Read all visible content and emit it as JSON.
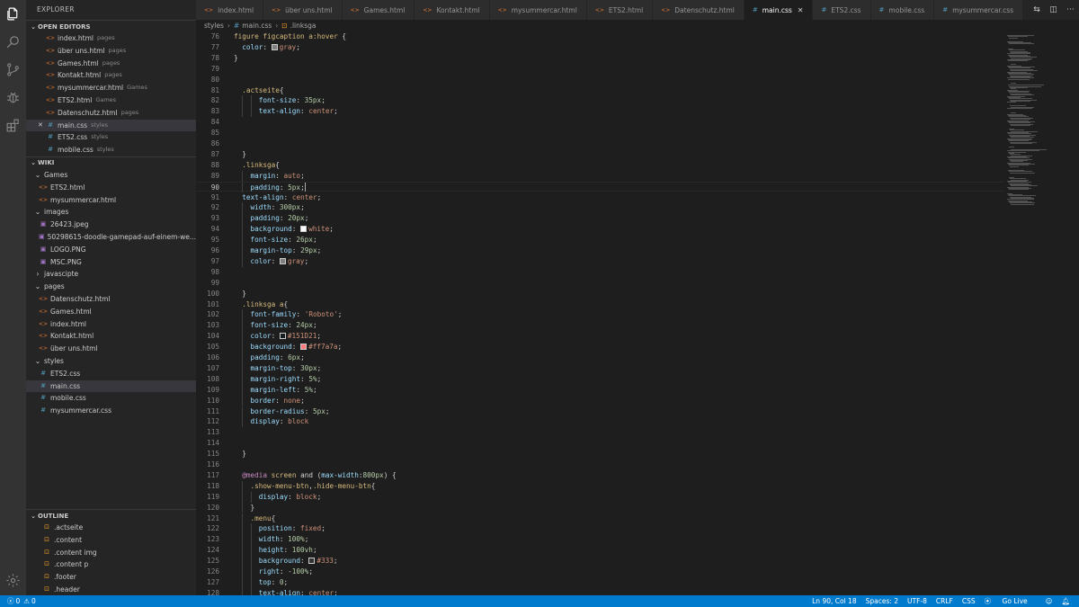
{
  "sidebar": {
    "title": "EXPLORER",
    "open_editors_header": "OPEN EDITORS",
    "open_editors": [
      {
        "name": "index.html",
        "folder": "pages",
        "type": "html"
      },
      {
        "name": "über uns.html",
        "folder": "pages",
        "type": "html"
      },
      {
        "name": "Games.html",
        "folder": "pages",
        "type": "html"
      },
      {
        "name": "Kontakt.html",
        "folder": "pages",
        "type": "html"
      },
      {
        "name": "mysummercar.html",
        "folder": "Games",
        "type": "html"
      },
      {
        "name": "ETS2.html",
        "folder": "Games",
        "type": "html"
      },
      {
        "name": "Datenschutz.html",
        "folder": "pages",
        "type": "html"
      },
      {
        "name": "main.css",
        "folder": "styles",
        "type": "css",
        "selected": true
      },
      {
        "name": "ETS2.css",
        "folder": "styles",
        "type": "css"
      },
      {
        "name": "mobile.css",
        "folder": "styles",
        "type": "css"
      }
    ],
    "workspace_header": "WIKI",
    "tree": [
      {
        "label": "Games",
        "kind": "folder",
        "depth": 1,
        "open": true
      },
      {
        "label": "ETS2.html",
        "kind": "html",
        "depth": 2
      },
      {
        "label": "mysummercar.html",
        "kind": "html",
        "depth": 2
      },
      {
        "label": "images",
        "kind": "folder",
        "depth": 1,
        "open": true
      },
      {
        "label": "26423.jpeg",
        "kind": "img",
        "depth": 2
      },
      {
        "label": "50298615-doodle-gamepad-auf-einem-we...",
        "kind": "img",
        "depth": 2
      },
      {
        "label": "LOGO.PNG",
        "kind": "img",
        "depth": 2
      },
      {
        "label": "MSC.PNG",
        "kind": "img",
        "depth": 2
      },
      {
        "label": "javascipte",
        "kind": "folder",
        "depth": 1,
        "open": false
      },
      {
        "label": "pages",
        "kind": "folder",
        "depth": 1,
        "open": true
      },
      {
        "label": "Datenschutz.html",
        "kind": "html",
        "depth": 2
      },
      {
        "label": "Games.html",
        "kind": "html",
        "depth": 2
      },
      {
        "label": "index.html",
        "kind": "html",
        "depth": 2
      },
      {
        "label": "Kontakt.html",
        "kind": "html",
        "depth": 2
      },
      {
        "label": "über uns.html",
        "kind": "html",
        "depth": 2
      },
      {
        "label": "styles",
        "kind": "folder",
        "depth": 1,
        "open": true
      },
      {
        "label": "ETS2.css",
        "kind": "css",
        "depth": 2
      },
      {
        "label": "main.css",
        "kind": "css",
        "depth": 2,
        "selected": true
      },
      {
        "label": "mobile.css",
        "kind": "css",
        "depth": 2
      },
      {
        "label": "mysummercar.css",
        "kind": "css",
        "depth": 2
      }
    ],
    "outline_header": "OUTLINE",
    "outline": [
      ".actseite",
      ".content",
      ".content img",
      ".content p",
      ".footer",
      ".header"
    ]
  },
  "tabs": [
    {
      "label": "index.html",
      "type": "html"
    },
    {
      "label": "über uns.html",
      "type": "html"
    },
    {
      "label": "Games.html",
      "type": "html"
    },
    {
      "label": "Kontakt.html",
      "type": "html"
    },
    {
      "label": "mysummercar.html",
      "type": "html"
    },
    {
      "label": "ETS2.html",
      "type": "html"
    },
    {
      "label": "Datenschutz.html",
      "type": "html"
    },
    {
      "label": "main.css",
      "type": "css",
      "active": true
    },
    {
      "label": "ETS2.css",
      "type": "css"
    },
    {
      "label": "mobile.css",
      "type": "css"
    },
    {
      "label": "mysummercar.css",
      "type": "css"
    }
  ],
  "breadcrumb": [
    "styles",
    "main.css",
    ".linksga"
  ],
  "editor": {
    "current_line": 90,
    "lines": [
      {
        "n": 76,
        "i": 0,
        "t": [
          [
            "sel",
            "figure figcaption a:hover "
          ],
          [
            "punc",
            "{"
          ]
        ]
      },
      {
        "n": 77,
        "i": 1,
        "t": [
          [
            "prop",
            "color"
          ],
          [
            "punc",
            ": "
          ],
          [
            "sw",
            "#808080"
          ],
          [
            "val",
            "gray"
          ],
          [
            "punc",
            ";"
          ]
        ]
      },
      {
        "n": 78,
        "i": 0,
        "t": [
          [
            "punc",
            "}"
          ]
        ]
      },
      {
        "n": 79,
        "i": 0,
        "t": []
      },
      {
        "n": 80,
        "i": 0,
        "t": []
      },
      {
        "n": 81,
        "i": 1,
        "t": [
          [
            "sel",
            ".actseite"
          ],
          [
            "punc",
            "{"
          ]
        ]
      },
      {
        "n": 82,
        "i": 3,
        "t": [
          [
            "prop",
            "font-size"
          ],
          [
            "punc",
            ": "
          ],
          [
            "num",
            "35px"
          ],
          [
            "punc",
            ";"
          ]
        ]
      },
      {
        "n": 83,
        "i": 3,
        "t": [
          [
            "prop",
            "text-align"
          ],
          [
            "punc",
            ": "
          ],
          [
            "val",
            "center"
          ],
          [
            "punc",
            ";"
          ]
        ]
      },
      {
        "n": 84,
        "i": 0,
        "t": []
      },
      {
        "n": 85,
        "i": 0,
        "t": []
      },
      {
        "n": 86,
        "i": 0,
        "t": []
      },
      {
        "n": 87,
        "i": 1,
        "t": [
          [
            "punc",
            "}"
          ]
        ]
      },
      {
        "n": 88,
        "i": 1,
        "t": [
          [
            "sel",
            ".linksga"
          ],
          [
            "punc",
            "{"
          ]
        ]
      },
      {
        "n": 89,
        "i": 2,
        "t": [
          [
            "prop",
            "margin"
          ],
          [
            "punc",
            ": "
          ],
          [
            "val",
            "auto"
          ],
          [
            "punc",
            ";"
          ]
        ]
      },
      {
        "n": 90,
        "i": 2,
        "t": [
          [
            "prop",
            "padding"
          ],
          [
            "punc",
            ": "
          ],
          [
            "num",
            "5px"
          ],
          [
            "punc",
            ";"
          ],
          [
            "cursor",
            ""
          ]
        ]
      },
      {
        "n": 91,
        "i": 1,
        "t": [
          [
            "prop",
            "text-align"
          ],
          [
            "punc",
            ": "
          ],
          [
            "val",
            "center"
          ],
          [
            "punc",
            ";"
          ]
        ]
      },
      {
        "n": 92,
        "i": 2,
        "t": [
          [
            "prop",
            "width"
          ],
          [
            "punc",
            ": "
          ],
          [
            "num",
            "300px"
          ],
          [
            "punc",
            ";"
          ]
        ]
      },
      {
        "n": 93,
        "i": 2,
        "t": [
          [
            "prop",
            "padding"
          ],
          [
            "punc",
            ": "
          ],
          [
            "num",
            "20px"
          ],
          [
            "punc",
            ";"
          ]
        ]
      },
      {
        "n": 94,
        "i": 2,
        "t": [
          [
            "prop",
            "background"
          ],
          [
            "punc",
            ": "
          ],
          [
            "sw",
            "#ffffff"
          ],
          [
            "val",
            "white"
          ],
          [
            "punc",
            ";"
          ]
        ]
      },
      {
        "n": 95,
        "i": 2,
        "t": [
          [
            "prop",
            "font-size"
          ],
          [
            "punc",
            ": "
          ],
          [
            "num",
            "26px"
          ],
          [
            "punc",
            ";"
          ]
        ]
      },
      {
        "n": 96,
        "i": 2,
        "t": [
          [
            "prop",
            "margin-top"
          ],
          [
            "punc",
            ": "
          ],
          [
            "num",
            "29px"
          ],
          [
            "punc",
            ";"
          ]
        ]
      },
      {
        "n": 97,
        "i": 2,
        "t": [
          [
            "prop",
            "color"
          ],
          [
            "punc",
            ": "
          ],
          [
            "sw",
            "#808080"
          ],
          [
            "val",
            "gray"
          ],
          [
            "punc",
            ";"
          ]
        ]
      },
      {
        "n": 98,
        "i": 0,
        "t": []
      },
      {
        "n": 99,
        "i": 0,
        "t": []
      },
      {
        "n": 100,
        "i": 1,
        "t": [
          [
            "punc",
            "}"
          ]
        ]
      },
      {
        "n": 101,
        "i": 1,
        "t": [
          [
            "sel",
            ".linksga a"
          ],
          [
            "punc",
            "{"
          ]
        ]
      },
      {
        "n": 102,
        "i": 2,
        "t": [
          [
            "prop",
            "font-family"
          ],
          [
            "punc",
            ": "
          ],
          [
            "val",
            "'Roboto'"
          ],
          [
            "punc",
            ";"
          ]
        ]
      },
      {
        "n": 103,
        "i": 2,
        "t": [
          [
            "prop",
            "font-size"
          ],
          [
            "punc",
            ": "
          ],
          [
            "num",
            "24px"
          ],
          [
            "punc",
            ";"
          ]
        ]
      },
      {
        "n": 104,
        "i": 2,
        "t": [
          [
            "prop",
            "color"
          ],
          [
            "punc",
            ": "
          ],
          [
            "sw",
            "#151D21"
          ],
          [
            "val",
            "#151D21"
          ],
          [
            "punc",
            ";"
          ]
        ]
      },
      {
        "n": 105,
        "i": 2,
        "t": [
          [
            "prop",
            "background"
          ],
          [
            "punc",
            ": "
          ],
          [
            "sw",
            "#ff7a7a"
          ],
          [
            "val",
            "#ff7a7a"
          ],
          [
            "punc",
            ";"
          ]
        ]
      },
      {
        "n": 106,
        "i": 2,
        "t": [
          [
            "prop",
            "padding"
          ],
          [
            "punc",
            ": "
          ],
          [
            "num",
            "6px"
          ],
          [
            "punc",
            ";"
          ]
        ]
      },
      {
        "n": 107,
        "i": 2,
        "t": [
          [
            "prop",
            "margin-top"
          ],
          [
            "punc",
            ": "
          ],
          [
            "num",
            "30px"
          ],
          [
            "punc",
            ";"
          ]
        ]
      },
      {
        "n": 108,
        "i": 2,
        "t": [
          [
            "prop",
            "margin-right"
          ],
          [
            "punc",
            ": "
          ],
          [
            "num",
            "5%"
          ],
          [
            "punc",
            ";"
          ]
        ]
      },
      {
        "n": 109,
        "i": 2,
        "t": [
          [
            "prop",
            "margin-left"
          ],
          [
            "punc",
            ": "
          ],
          [
            "num",
            "5%"
          ],
          [
            "punc",
            ";"
          ]
        ]
      },
      {
        "n": 110,
        "i": 2,
        "t": [
          [
            "prop",
            "border"
          ],
          [
            "punc",
            ": "
          ],
          [
            "val",
            "none"
          ],
          [
            "punc",
            ";"
          ]
        ]
      },
      {
        "n": 111,
        "i": 2,
        "t": [
          [
            "prop",
            "border-radius"
          ],
          [
            "punc",
            ": "
          ],
          [
            "num",
            "5px"
          ],
          [
            "punc",
            ";"
          ]
        ]
      },
      {
        "n": 112,
        "i": 2,
        "t": [
          [
            "prop",
            "display"
          ],
          [
            "punc",
            ": "
          ],
          [
            "val",
            "block"
          ]
        ]
      },
      {
        "n": 113,
        "i": 0,
        "t": []
      },
      {
        "n": 114,
        "i": 0,
        "t": []
      },
      {
        "n": 115,
        "i": 1,
        "t": [
          [
            "punc",
            "}"
          ]
        ]
      },
      {
        "n": 116,
        "i": 0,
        "t": []
      },
      {
        "n": 117,
        "i": 1,
        "t": [
          [
            "at",
            "@media"
          ],
          [
            "punc",
            " "
          ],
          [
            "sel",
            "screen"
          ],
          [
            "punc",
            " and ("
          ],
          [
            "prop",
            "max-width"
          ],
          [
            "punc",
            ":"
          ],
          [
            "num",
            "800px"
          ],
          [
            "punc",
            ") {"
          ]
        ]
      },
      {
        "n": 118,
        "i": 2,
        "t": [
          [
            "sel",
            ".show-menu-btn"
          ],
          [
            "punc",
            ","
          ],
          [
            "sel",
            ".hide-menu-btn"
          ],
          [
            "punc",
            "{"
          ]
        ]
      },
      {
        "n": 119,
        "i": 3,
        "t": [
          [
            "prop",
            "display"
          ],
          [
            "punc",
            ": "
          ],
          [
            "val",
            "block"
          ],
          [
            "punc",
            ";"
          ]
        ]
      },
      {
        "n": 120,
        "i": 2,
        "t": [
          [
            "punc",
            "}"
          ]
        ]
      },
      {
        "n": 121,
        "i": 2,
        "t": [
          [
            "sel",
            ".menu"
          ],
          [
            "punc",
            "{"
          ]
        ]
      },
      {
        "n": 122,
        "i": 3,
        "t": [
          [
            "prop",
            "position"
          ],
          [
            "punc",
            ": "
          ],
          [
            "val",
            "fixed"
          ],
          [
            "punc",
            ";"
          ]
        ]
      },
      {
        "n": 123,
        "i": 3,
        "t": [
          [
            "prop",
            "width"
          ],
          [
            "punc",
            ": "
          ],
          [
            "num",
            "100%"
          ],
          [
            "punc",
            ";"
          ]
        ]
      },
      {
        "n": 124,
        "i": 3,
        "t": [
          [
            "prop",
            "height"
          ],
          [
            "punc",
            ": "
          ],
          [
            "num",
            "100vh"
          ],
          [
            "punc",
            ";"
          ]
        ]
      },
      {
        "n": 125,
        "i": 3,
        "t": [
          [
            "prop",
            "background"
          ],
          [
            "punc",
            ": "
          ],
          [
            "sw",
            "#333333"
          ],
          [
            "val",
            "#333"
          ],
          [
            "punc",
            ";"
          ]
        ]
      },
      {
        "n": 126,
        "i": 3,
        "t": [
          [
            "prop",
            "right"
          ],
          [
            "punc",
            ": "
          ],
          [
            "num",
            "-100%"
          ],
          [
            "punc",
            ";"
          ]
        ]
      },
      {
        "n": 127,
        "i": 3,
        "t": [
          [
            "prop",
            "top"
          ],
          [
            "punc",
            ": "
          ],
          [
            "num",
            "0"
          ],
          [
            "punc",
            ";"
          ]
        ]
      },
      {
        "n": 128,
        "i": 3,
        "t": [
          [
            "prop",
            "text-align"
          ],
          [
            "punc",
            ": "
          ],
          [
            "val",
            "center"
          ],
          [
            "punc",
            ";"
          ]
        ]
      }
    ]
  },
  "statusbar": {
    "errors": "0",
    "warnings": "0",
    "position": "Ln 90, Col 18",
    "spaces": "Spaces: 2",
    "encoding": "UTF-8",
    "eol": "CRLF",
    "language": "CSS",
    "go_live": "Go Live"
  },
  "colors": {
    "accent": "#007acc",
    "sidebar_bg": "#252526",
    "editor_bg": "#1e1e1e",
    "activity_bg": "#333333"
  },
  "icons": [
    "files-icon",
    "search-icon",
    "source-control-icon",
    "debug-icon",
    "extensions-icon",
    "settings-gear-icon",
    "error-icon",
    "warning-icon",
    "split-editor-icon",
    "more-actions-icon"
  ]
}
